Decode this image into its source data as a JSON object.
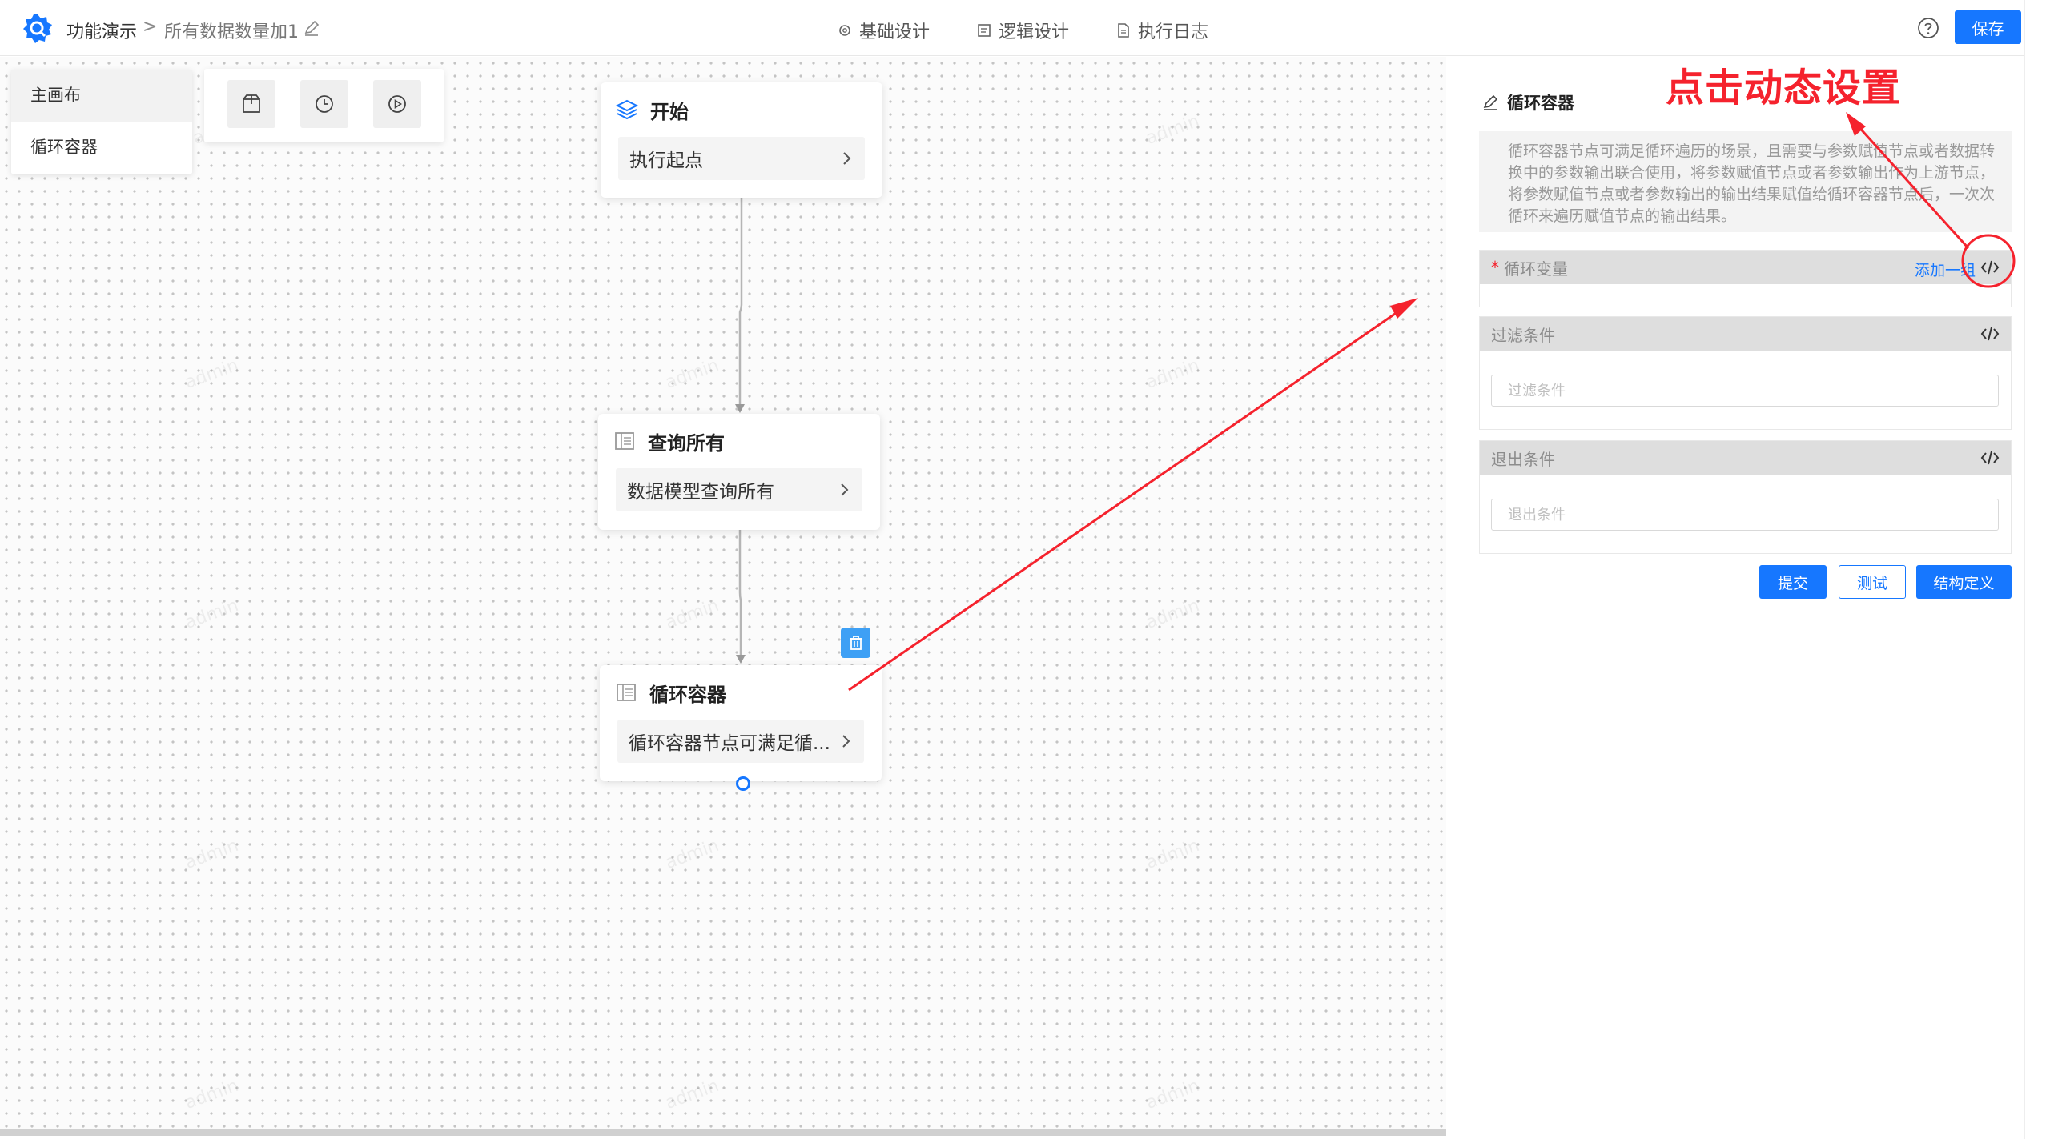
{
  "topbar": {
    "app_name": "功能演示",
    "separator": ">",
    "page_name": "所有数据数量加1",
    "tabs": [
      {
        "label": "基础设计",
        "icon": "gear-icon"
      },
      {
        "label": "逻辑设计",
        "icon": "logic-icon"
      },
      {
        "label": "执行日志",
        "icon": "document-icon"
      }
    ],
    "save_label": "保存",
    "accent_color": "#1677ff"
  },
  "canvas_menu": {
    "items": [
      "主画布",
      "循环容器"
    ]
  },
  "toolbar": {
    "tools": [
      "package-icon",
      "clock-icon",
      "play-icon"
    ]
  },
  "nodes": {
    "start": {
      "title": "开始",
      "body": "执行起点",
      "icon": "layers-icon"
    },
    "query": {
      "title": "查询所有",
      "body": "数据模型查询所有",
      "icon": "table-icon"
    },
    "loop": {
      "title": "循环容器",
      "body": "循环容器节点可满足循...",
      "icon": "table-icon"
    }
  },
  "watermark_text": "admin",
  "panel": {
    "title": "循环容器",
    "description": "循环容器节点可满足循环遍历的场景，且需要与参数赋值节点或者数据转换中的参数输出联合使用，将参数赋值节点或者参数输出作为上游节点，将参数赋值节点或者参数输出的输出结果赋值给循环容器节点后，一次次循环来遍历赋值节点的输出结果。",
    "loop_var": {
      "required_mark": "*",
      "label": "循环变量",
      "add_label": "添加一组"
    },
    "filter": {
      "label": "过滤条件",
      "placeholder": "过滤条件",
      "value": ""
    },
    "exit": {
      "label": "退出条件",
      "placeholder": "退出条件",
      "value": ""
    },
    "buttons": {
      "submit": "提交",
      "test": "测试",
      "schema": "结构定义"
    }
  },
  "annotation": {
    "text": "点击动态设置",
    "color": "#f5222d"
  }
}
